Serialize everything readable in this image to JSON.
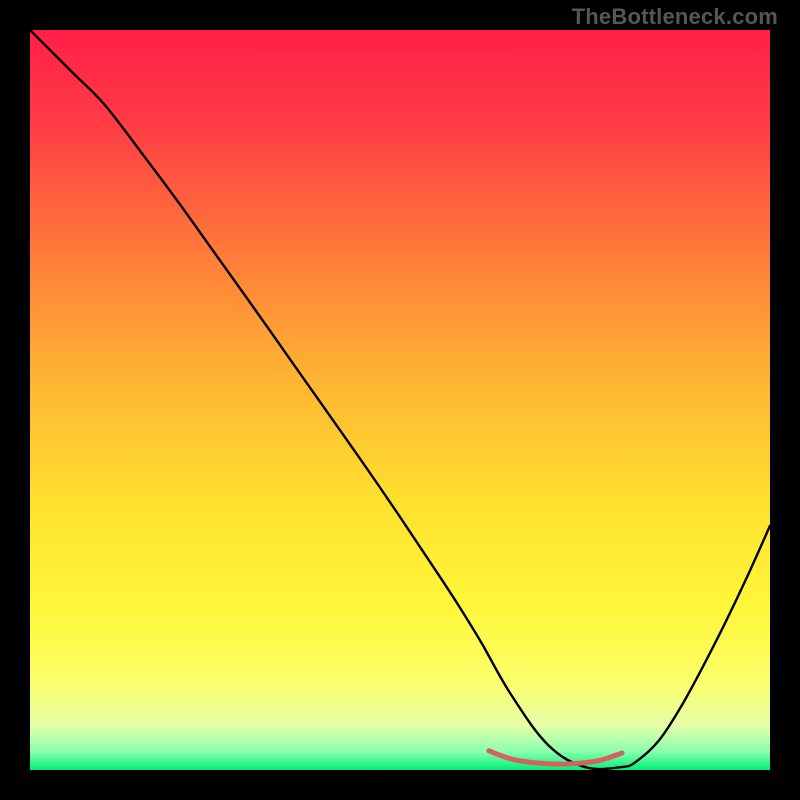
{
  "watermark": "TheBottleneck.com",
  "chart_data": {
    "type": "line",
    "title": "",
    "xlabel": "",
    "ylabel": "",
    "xlim": [
      0,
      100
    ],
    "ylim": [
      0,
      100
    ],
    "background_gradient": {
      "stops": [
        {
          "pos": 0.0,
          "color": "#ff1f47"
        },
        {
          "pos": 0.12,
          "color": "#ff3a45"
        },
        {
          "pos": 0.3,
          "color": "#ff7a3a"
        },
        {
          "pos": 0.48,
          "color": "#ffb733"
        },
        {
          "pos": 0.64,
          "color": "#ffe12e"
        },
        {
          "pos": 0.78,
          "color": "#fff73a"
        },
        {
          "pos": 0.88,
          "color": "#fbff6a"
        },
        {
          "pos": 0.94,
          "color": "#e5ffa8"
        },
        {
          "pos": 0.975,
          "color": "#8affad"
        },
        {
          "pos": 1.0,
          "color": "#00f07a"
        }
      ]
    },
    "series": [
      {
        "name": "bottleneck-curve",
        "color": "#000000",
        "x": [
          0,
          3,
          6,
          10,
          15,
          20,
          25,
          30,
          35,
          40,
          45,
          50,
          55,
          58,
          61,
          65,
          70,
          75,
          80,
          82,
          85,
          88,
          91,
          94,
          97,
          100
        ],
        "y": [
          100,
          97,
          94,
          90,
          83.5,
          76.8,
          69.8,
          62.8,
          55.7,
          48.6,
          41.5,
          34.2,
          26.7,
          22.1,
          17.2,
          10.2,
          3.4,
          0.4,
          0.4,
          1.2,
          4.0,
          8.6,
          14.1,
          20.0,
          26.3,
          33.0
        ]
      },
      {
        "name": "trough-highlight",
        "color": "#d8615e",
        "width": 5,
        "x": [
          62,
          65,
          68,
          71,
          74,
          77,
          80
        ],
        "y": [
          2.6,
          1.5,
          1.0,
          0.8,
          0.9,
          1.3,
          2.3
        ]
      }
    ]
  }
}
